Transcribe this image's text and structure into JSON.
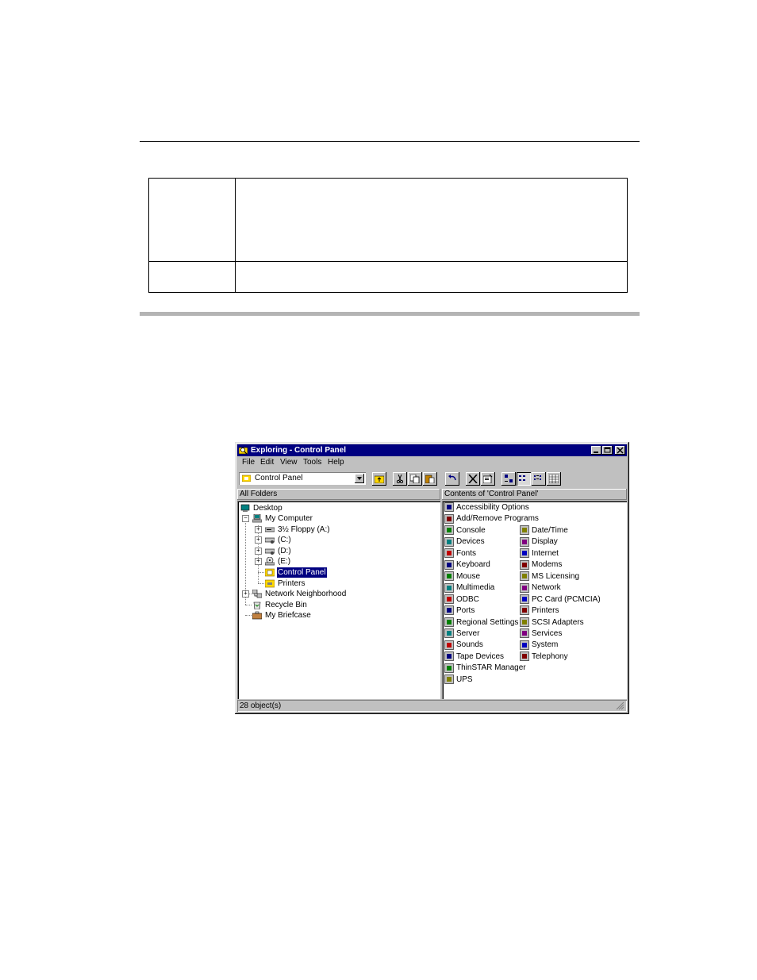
{
  "window": {
    "title": "Exploring - Control Panel",
    "menus": [
      "File",
      "Edit",
      "View",
      "Tools",
      "Help"
    ],
    "address": "Control Panel",
    "left_header": "All Folders",
    "right_header": "Contents of 'Control Panel'",
    "status": "28 object(s)"
  },
  "tree": [
    {
      "label": "Desktop",
      "icon": "desktop-icon"
    },
    {
      "label": "My Computer",
      "icon": "computer-icon"
    },
    {
      "label": "3½ Floppy (A:)",
      "icon": "floppy-icon"
    },
    {
      "label": "(C:)",
      "icon": "drive-icon"
    },
    {
      "label": "(D:)",
      "icon": "drive-icon"
    },
    {
      "label": "(E:)",
      "icon": "cdrom-icon"
    },
    {
      "label": "Control Panel",
      "icon": "control-panel-icon"
    },
    {
      "label": "Printers",
      "icon": "printers-folder-icon"
    },
    {
      "label": "Network Neighborhood",
      "icon": "network-icon"
    },
    {
      "label": "Recycle Bin",
      "icon": "recycle-bin-icon"
    },
    {
      "label": "My Briefcase",
      "icon": "briefcase-icon"
    }
  ],
  "contents": [
    "Accessibility Options",
    "Add/Remove Programs",
    "Console",
    "Date/Time",
    "Devices",
    "Display",
    "Fonts",
    "Internet",
    "Keyboard",
    "Modems",
    "Mouse",
    "MS Licensing",
    "Multimedia",
    "Network",
    "ODBC",
    "PC Card (PCMCIA)",
    "Ports",
    "Printers",
    "Regional Settings",
    "SCSI Adapters",
    "Server",
    "Services",
    "Sounds",
    "System",
    "Tape Devices",
    "Telephony",
    "ThinSTAR Manager",
    "UPS"
  ],
  "colors": {
    "titlebar": "#000080",
    "chrome": "#c0c0c0",
    "selection": "#000080"
  }
}
